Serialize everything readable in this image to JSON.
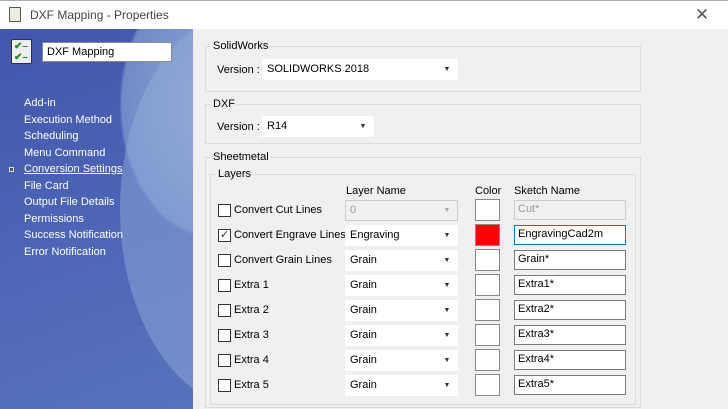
{
  "window": {
    "title": "DXF Mapping - Properties",
    "close_icon": "close-icon"
  },
  "sidebar": {
    "name_value": "DXF Mapping",
    "items": [
      {
        "label": "Add-in"
      },
      {
        "label": "Execution Method"
      },
      {
        "label": "Scheduling"
      },
      {
        "label": "Menu Command"
      },
      {
        "label": "Conversion Settings",
        "selected": true
      },
      {
        "label": "File Card"
      },
      {
        "label": "Output File Details"
      },
      {
        "label": "Permissions"
      },
      {
        "label": "Success Notification"
      },
      {
        "label": "Error Notification"
      }
    ]
  },
  "solidworks": {
    "legend": "SolidWorks",
    "version_label": "Version :",
    "version_value": "SOLIDWORKS 2018"
  },
  "dxf": {
    "legend": "DXF",
    "version_label": "Version :",
    "version_value": "R14"
  },
  "sheetmetal": {
    "legend": "Sheetmetal",
    "layers": {
      "legend": "Layers",
      "headers": {
        "layer_name": "Layer Name",
        "color": "Color",
        "sketch_name": "Sketch Name"
      },
      "rows": [
        {
          "label": "Convert Cut Lines",
          "checked": false,
          "layer": "0",
          "disabled": true,
          "color": "#ffffff",
          "sketch": "Cut*"
        },
        {
          "label": "Convert Engrave Lines",
          "checked": true,
          "layer": "Engraving",
          "disabled": false,
          "color": "#ff0000",
          "sketch": "EngravingCad2m"
        },
        {
          "label": "Convert Grain Lines",
          "checked": false,
          "layer": "Grain",
          "disabled": false,
          "color": "#ffffff",
          "sketch": "Grain*"
        },
        {
          "label": "Extra 1",
          "checked": false,
          "layer": "Grain",
          "disabled": false,
          "color": "#ffffff",
          "sketch": "Extra1*"
        },
        {
          "label": "Extra 2",
          "checked": false,
          "layer": "Grain",
          "disabled": false,
          "color": "#ffffff",
          "sketch": "Extra2*"
        },
        {
          "label": "Extra 3",
          "checked": false,
          "layer": "Grain",
          "disabled": false,
          "color": "#ffffff",
          "sketch": "Extra3*"
        },
        {
          "label": "Extra 4",
          "checked": false,
          "layer": "Grain",
          "disabled": false,
          "color": "#ffffff",
          "sketch": "Extra4*"
        },
        {
          "label": "Extra 5",
          "checked": false,
          "layer": "Grain",
          "disabled": false,
          "color": "#ffffff",
          "sketch": "Extra5*"
        }
      ]
    }
  }
}
